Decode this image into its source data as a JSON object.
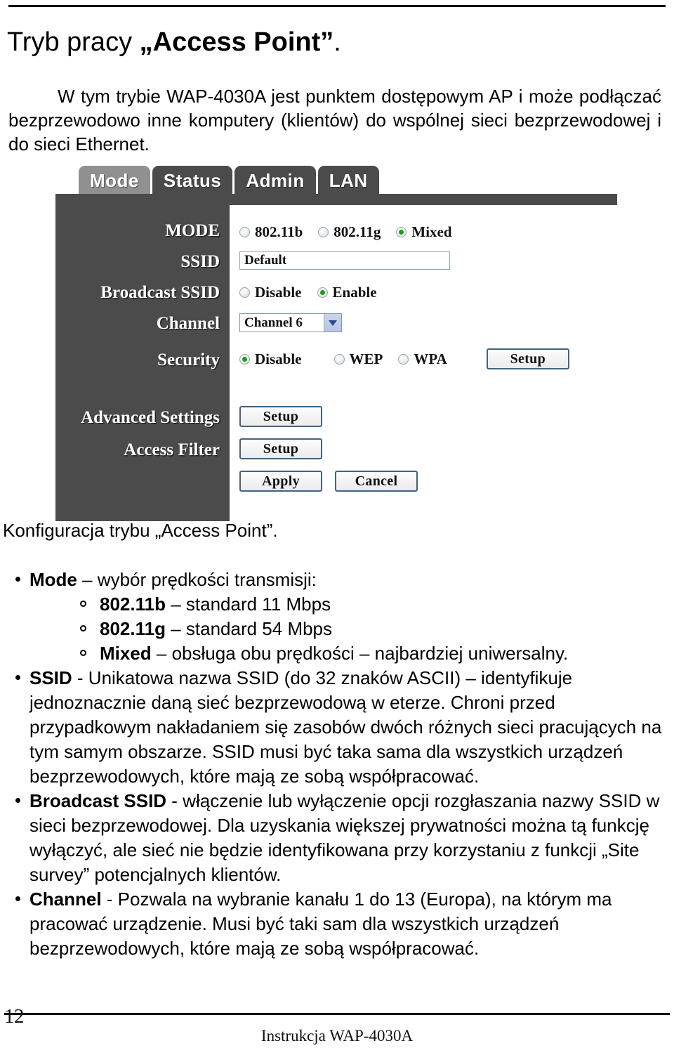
{
  "document": {
    "title_plain": "Tryb pracy ",
    "title_bold": "„Access Point”",
    "title_tail": ".",
    "intro_paragraph": "W tym trybie WAP-4030A jest punktem dostępowym AP i może podłączać bezprzewodowo inne komputery (klientów) do wspólnej sieci bezprzewodowej i do sieci Ethernet.",
    "sub_heading": "Konfiguracja trybu „Access Point”.",
    "page_number": "12",
    "footer_text": "Instrukcja WAP-4030A"
  },
  "bullets": [
    {
      "label": "Mode",
      "text": " – wybór prędkości transmisji:",
      "sub_items": [
        {
          "label": "802.11b",
          "text": " – standard 11 Mbps"
        },
        {
          "label": "802.11g",
          "text": " – standard 54 Mbps"
        },
        {
          "label": "Mixed",
          "text": " – obsługa obu prędkości – najbardziej uniwersalny."
        }
      ]
    },
    {
      "label": "SSID",
      "text": " - Unikatowa nazwa SSID (do 32 znaków ASCII) – identyfikuje jednoznacznie daną sieć bezprzewodową w eterze. Chroni przed przypadkowym nakładaniem się zasobów dwóch różnych sieci pracujących na tym samym obszarze. SSID musi być taka sama dla wszystkich urządzeń bezprzewodowych, które mają ze sobą współpracować.",
      "sub_items": []
    },
    {
      "label": "Broadcast SSID",
      "text": " -  włączenie lub wyłączenie opcji rozgłaszania nazwy SSID w sieci bezprzewodowej. Dla uzyskania większej prywatności można tą funkcję wyłączyć, ale sieć nie będzie identyfikowana przy korzystaniu z funkcji „Site survey” potencjalnych klientów.",
      "sub_items": []
    },
    {
      "label": "Channel",
      "text": " - Pozwala na wybranie kanału 1 do 13 (Europa), na którym ma pracować urządzenie. Musi być taki sam dla wszystkich urządzeń bezprzewodowych, które mają ze sobą współpracować.",
      "sub_items": []
    }
  ],
  "router_ui": {
    "tabs": [
      {
        "label": "Mode",
        "active": true
      },
      {
        "label": "Status",
        "active": false
      },
      {
        "label": "Admin",
        "active": false
      },
      {
        "label": "LAN",
        "active": false
      }
    ],
    "sidebar_labels": [
      "MODE",
      "SSID",
      "Broadcast SSID",
      "Channel",
      "Security",
      "Advanced Settings",
      "Access Filter"
    ],
    "mode_row": {
      "options": [
        {
          "label": "802.11b",
          "selected": false
        },
        {
          "label": "802.11g",
          "selected": false
        },
        {
          "label": "Mixed",
          "selected": true
        }
      ]
    },
    "ssid_row": {
      "value": "Default"
    },
    "broadcast_row": {
      "options": [
        {
          "label": "Disable",
          "selected": false
        },
        {
          "label": "Enable",
          "selected": true
        }
      ]
    },
    "channel_row": {
      "value": "Channel 6"
    },
    "security_row": {
      "options": [
        {
          "label": "Disable",
          "selected": true
        },
        {
          "label": "WEP",
          "selected": false
        },
        {
          "label": "WPA",
          "selected": false
        }
      ],
      "setup_label": "Setup"
    },
    "advanced_row": {
      "setup_label": "Setup"
    },
    "access_filter_row": {
      "setup_label": "Setup"
    },
    "action_row": {
      "apply_label": "Apply",
      "cancel_label": "Cancel"
    },
    "colors": {
      "panel_dark": "#4b4b4b",
      "tab_active": "#909090",
      "radio_selected": "#1aa11a",
      "button_border": "#42647f"
    }
  }
}
